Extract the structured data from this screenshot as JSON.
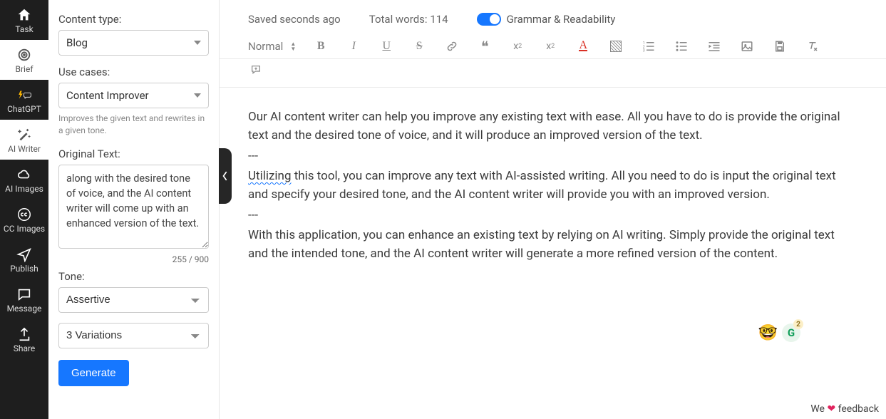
{
  "nav": {
    "items": [
      {
        "id": "task",
        "label": "Task"
      },
      {
        "id": "brief",
        "label": "Brief"
      },
      {
        "id": "chatgpt",
        "label": "ChatGPT"
      },
      {
        "id": "aiwriter",
        "label": "AI Writer"
      },
      {
        "id": "aiimages",
        "label": "AI Images"
      },
      {
        "id": "ccimages",
        "label": "CC Images"
      },
      {
        "id": "publish",
        "label": "Publish"
      },
      {
        "id": "message",
        "label": "Message"
      },
      {
        "id": "share",
        "label": "Share"
      }
    ]
  },
  "sidebar": {
    "contentTypeLabel": "Content type:",
    "contentTypeValue": "Blog",
    "useCasesLabel": "Use cases:",
    "useCasesValue": "Content Improver",
    "useCasesHelper": "Improves the given text and rewrites in a given tone.",
    "originalTextLabel": "Original Text:",
    "originalTextValue": "along with the desired tone of voice, and the AI content writer will come up with an enhanced version of the text.",
    "counter": "255 / 900",
    "toneLabel": "Tone:",
    "toneValue": "Assertive",
    "variationsValue": "3 Variations",
    "generateLabel": "Generate"
  },
  "status": {
    "saved": "Saved seconds ago",
    "words": "Total words: 114",
    "grammar": "Grammar & Readability"
  },
  "toolbar": {
    "normal": "Normal"
  },
  "doc": {
    "p1": "Our AI content writer can help you improve any existing text with ease. All you have to do is provide the original text and the desired tone of voice, and it will produce an improved version of the text.",
    "sep": "---",
    "p2a": "Utilizing",
    "p2b": " this tool, you can improve any text with AI-assisted writing. All you need to do is input the original text and specify your desired tone, and the AI content writer will provide you with an improved version.",
    "p3": "With this application, you can enhance an existing text by relying on AI writing. Simply provide the original text and the intended tone, and the AI content writer will generate a more refined version of the content."
  },
  "badges": {
    "emoji": "🤓",
    "g": "G",
    "gcount": "2"
  },
  "footer": {
    "pre": "We ",
    "post": " feedback"
  }
}
